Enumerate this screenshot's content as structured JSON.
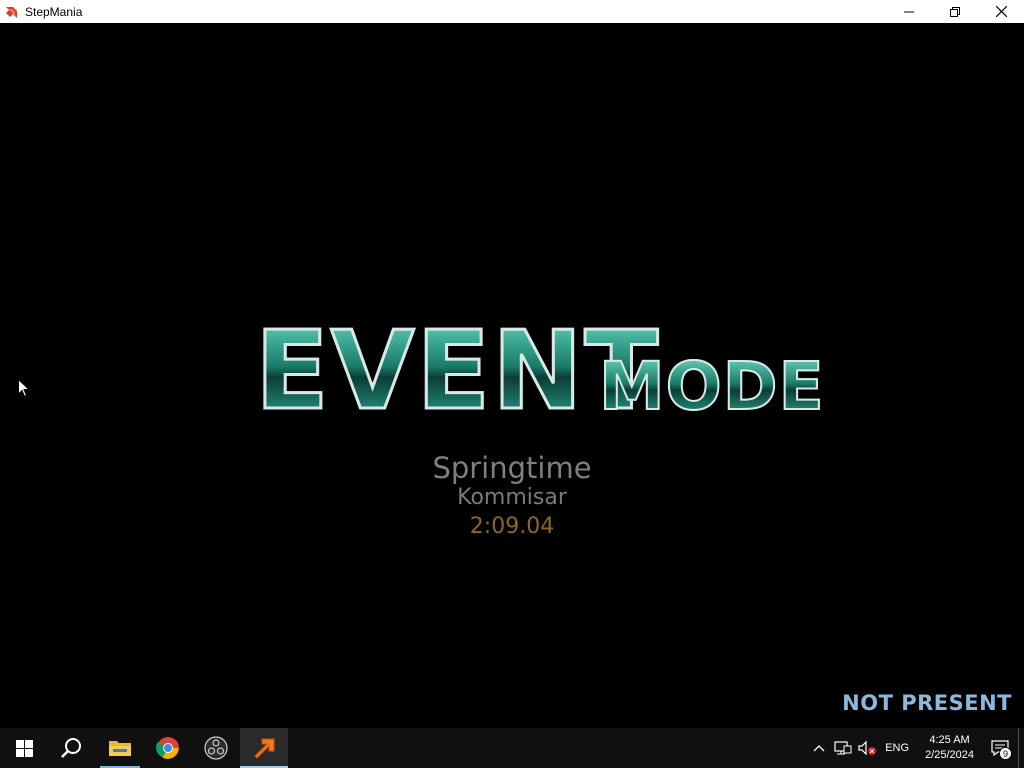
{
  "window": {
    "title": "StepMania",
    "app_icon": "stepmania-arrow-icon",
    "controls": [
      "minimize-icon",
      "restore-icon",
      "close-icon"
    ]
  },
  "screen": {
    "logo_main": "EVENT",
    "logo_sub": "MODE",
    "song_title": "Springtime",
    "song_artist": "Kommisar",
    "song_length": "2:09.04",
    "player_status": "NOT PRESENT"
  },
  "colors": {
    "logo_teal": "#1f8f7a",
    "song_title": "#7f7f7f",
    "song_length": "#8a6a22",
    "player_status": "#8ab8df",
    "taskbar_bg": "#101010"
  },
  "taskbar": {
    "items": [
      {
        "name": "start-button",
        "icon": "windows-logo-icon"
      },
      {
        "name": "search-button",
        "icon": "search-icon"
      },
      {
        "name": "file-explorer",
        "icon": "folder-icon"
      },
      {
        "name": "chrome",
        "icon": "chrome-icon"
      },
      {
        "name": "obs",
        "icon": "obs-icon"
      },
      {
        "name": "stepmania",
        "icon": "stepmania-arrow-icon"
      }
    ],
    "tray": {
      "lang": "ENG",
      "time": "4:25 AM",
      "date": "2/25/2024",
      "notification_count": "9"
    }
  }
}
